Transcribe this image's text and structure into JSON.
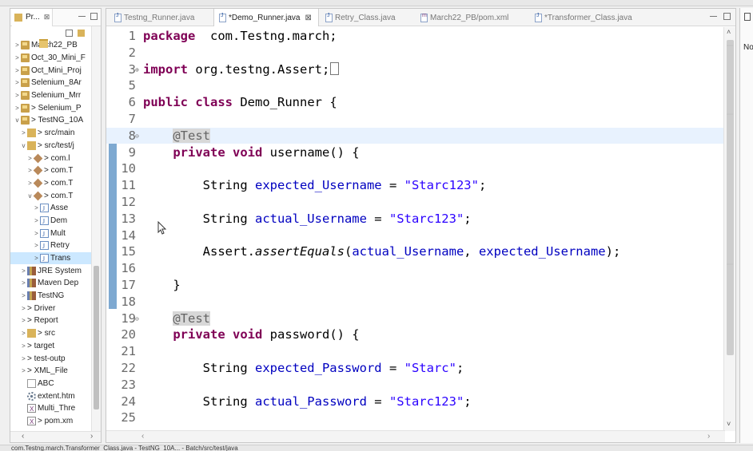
{
  "explorer": {
    "tab_label": "Pr...",
    "close_glyph": "⊠",
    "items": [
      {
        "label": "March22_PB",
        "indent": 0,
        "icon": "project-icon",
        "toggle": ">"
      },
      {
        "label": "Oct_30_Mini_F",
        "indent": 0,
        "icon": "project-icon",
        "toggle": ">"
      },
      {
        "label": "Oct_Mini_Proj",
        "indent": 0,
        "icon": "project-icon",
        "toggle": ">"
      },
      {
        "label": "Selenium_8Ar",
        "indent": 0,
        "icon": "project-icon",
        "toggle": ">"
      },
      {
        "label": "Selenium_Mrr",
        "indent": 0,
        "icon": "project-icon",
        "toggle": ">"
      },
      {
        "label": "> Selenium_P",
        "indent": 0,
        "icon": "project-icon",
        "toggle": ">"
      },
      {
        "label": "> TestNG_10A",
        "indent": 0,
        "icon": "project-icon",
        "toggle": "v"
      },
      {
        "label": "> src/main",
        "indent": 1,
        "icon": "package-folder-icon",
        "toggle": ">"
      },
      {
        "label": "> src/test/j",
        "indent": 1,
        "icon": "package-folder-icon",
        "toggle": "v"
      },
      {
        "label": "> com.l",
        "indent": 2,
        "icon": "package-icon",
        "toggle": ">"
      },
      {
        "label": "> com.T",
        "indent": 2,
        "icon": "package-icon",
        "toggle": ">"
      },
      {
        "label": "> com.T",
        "indent": 2,
        "icon": "package-icon",
        "toggle": ">"
      },
      {
        "label": "> com.T",
        "indent": 2,
        "icon": "package-icon",
        "toggle": "v"
      },
      {
        "label": "Asse",
        "indent": 3,
        "icon": "java-file-icon",
        "toggle": ">"
      },
      {
        "label": "Dem",
        "indent": 3,
        "icon": "java-file-icon",
        "toggle": ">"
      },
      {
        "label": "Mult",
        "indent": 3,
        "icon": "java-file-icon",
        "toggle": ">"
      },
      {
        "label": "Retry",
        "indent": 3,
        "icon": "java-file-icon",
        "toggle": ">"
      },
      {
        "label": "Trans",
        "indent": 3,
        "icon": "java-file-icon",
        "toggle": ">",
        "selected": true
      },
      {
        "label": "JRE System",
        "indent": 1,
        "icon": "library-icon",
        "toggle": ">"
      },
      {
        "label": "Maven Dep",
        "indent": 1,
        "icon": "library-icon",
        "toggle": ">"
      },
      {
        "label": "TestNG",
        "indent": 1,
        "icon": "library-icon",
        "toggle": ">"
      },
      {
        "label": "> Driver",
        "indent": 1,
        "icon": "folder-icon",
        "toggle": ">"
      },
      {
        "label": "> Report",
        "indent": 1,
        "icon": "folder-icon",
        "toggle": ">"
      },
      {
        "label": "> src",
        "indent": 1,
        "icon": "package-folder-icon",
        "toggle": ">"
      },
      {
        "label": "> target",
        "indent": 1,
        "icon": "folder-icon",
        "toggle": ">"
      },
      {
        "label": "> test-outp",
        "indent": 1,
        "icon": "folder-icon",
        "toggle": ">"
      },
      {
        "label": "> XML_File",
        "indent": 1,
        "icon": "folder-icon",
        "toggle": ">"
      },
      {
        "label": "ABC",
        "indent": 1,
        "icon": "file-icon",
        "toggle": ""
      },
      {
        "label": "extent.htm",
        "indent": 1,
        "icon": "gear-icon",
        "toggle": ""
      },
      {
        "label": "Multi_Thre",
        "indent": 1,
        "icon": "xml-file-icon",
        "toggle": ""
      },
      {
        "label": "> pom.xm",
        "indent": 1,
        "icon": "xml-file-icon",
        "toggle": ""
      }
    ]
  },
  "editor": {
    "tabs": [
      {
        "label": "Testng_Runner.java",
        "active": false,
        "icon": "java"
      },
      {
        "label": "*Demo_Runner.java",
        "active": true,
        "icon": "java",
        "close": "⊠"
      },
      {
        "label": "Retry_Class.java",
        "active": false,
        "icon": "java"
      },
      {
        "label": "March22_PB/pom.xml",
        "active": false,
        "icon": "xml"
      },
      {
        "label": "*Transformer_Class.java",
        "active": false,
        "icon": "java"
      }
    ],
    "lines": [
      {
        "n": "1",
        "tokens": [
          [
            "kw",
            "package"
          ],
          [
            "",
            "  com.Testng.march;"
          ]
        ]
      },
      {
        "n": "2",
        "tokens": []
      },
      {
        "n": "3",
        "fold": "⊕",
        "tokens": [
          [
            "kw",
            "import"
          ],
          [
            "",
            " org.testng.Assert;"
          ],
          [
            "box",
            ""
          ]
        ]
      },
      {
        "n": "5",
        "tokens": []
      },
      {
        "n": "6",
        "tokens": [
          [
            "kw",
            "public"
          ],
          [
            "",
            " "
          ],
          [
            "kw",
            "class"
          ],
          [
            "",
            " Demo_Runner {"
          ]
        ]
      },
      {
        "n": "7",
        "tokens": []
      },
      {
        "n": "8",
        "fold": "⊖",
        "current": true,
        "tokens": [
          [
            "",
            "    "
          ],
          [
            "ann",
            "@Test"
          ]
        ]
      },
      {
        "n": "9",
        "tokens": [
          [
            "",
            "    "
          ],
          [
            "kw",
            "private"
          ],
          [
            "",
            " "
          ],
          [
            "kw",
            "void"
          ],
          [
            "",
            " username() {"
          ]
        ]
      },
      {
        "n": "10",
        "tokens": []
      },
      {
        "n": "11",
        "tokens": [
          [
            "",
            "        String "
          ],
          [
            "fld",
            "expected_Username"
          ],
          [
            "",
            " = "
          ],
          [
            "str",
            "\"Starc123\""
          ],
          [
            "",
            ";"
          ]
        ]
      },
      {
        "n": "12",
        "tokens": []
      },
      {
        "n": "13",
        "tokens": [
          [
            "",
            "        String "
          ],
          [
            "fld",
            "actual_Username"
          ],
          [
            "",
            " = "
          ],
          [
            "str",
            "\"Starc123\""
          ],
          [
            "",
            ";"
          ]
        ]
      },
      {
        "n": "14",
        "tokens": []
      },
      {
        "n": "15",
        "tokens": [
          [
            "",
            "        Assert."
          ],
          [
            "itl",
            "assertEquals"
          ],
          [
            "",
            "("
          ],
          [
            "fld",
            "actual_Username"
          ],
          [
            "",
            ", "
          ],
          [
            "fld",
            "expected_Username"
          ],
          [
            "",
            ");"
          ]
        ]
      },
      {
        "n": "16",
        "tokens": []
      },
      {
        "n": "17",
        "tokens": [
          [
            "",
            "    }"
          ]
        ]
      },
      {
        "n": "18",
        "tokens": []
      },
      {
        "n": "19",
        "fold": "⊖",
        "tokens": [
          [
            "",
            "    "
          ],
          [
            "ann",
            "@Test"
          ]
        ]
      },
      {
        "n": "20",
        "tokens": [
          [
            "",
            "    "
          ],
          [
            "kw",
            "private"
          ],
          [
            "",
            " "
          ],
          [
            "kw",
            "void"
          ],
          [
            "",
            " password() {"
          ]
        ]
      },
      {
        "n": "21",
        "tokens": []
      },
      {
        "n": "22",
        "tokens": [
          [
            "",
            "        String "
          ],
          [
            "fld",
            "expected_Password"
          ],
          [
            "",
            " = "
          ],
          [
            "str",
            "\"Starc\""
          ],
          [
            "",
            ";"
          ]
        ]
      },
      {
        "n": "23",
        "tokens": []
      },
      {
        "n": "24",
        "tokens": [
          [
            "",
            "        String "
          ],
          [
            "fld",
            "actual_Password"
          ],
          [
            "",
            " = "
          ],
          [
            "str",
            "\"Starc123\""
          ],
          [
            "",
            ";"
          ]
        ]
      },
      {
        "n": "25",
        "tokens": []
      }
    ]
  },
  "right_panel": {
    "label": "No"
  },
  "status_bar": {
    "text": "com.Testng.march.Transformer_Class.java - TestNG_10A... - Batch/src/test/java"
  },
  "colors": {
    "keyword": "#7f0055",
    "string": "#2a00ff",
    "field": "#0000c0",
    "annotation": "#646464",
    "selection": "#cce8ff"
  }
}
